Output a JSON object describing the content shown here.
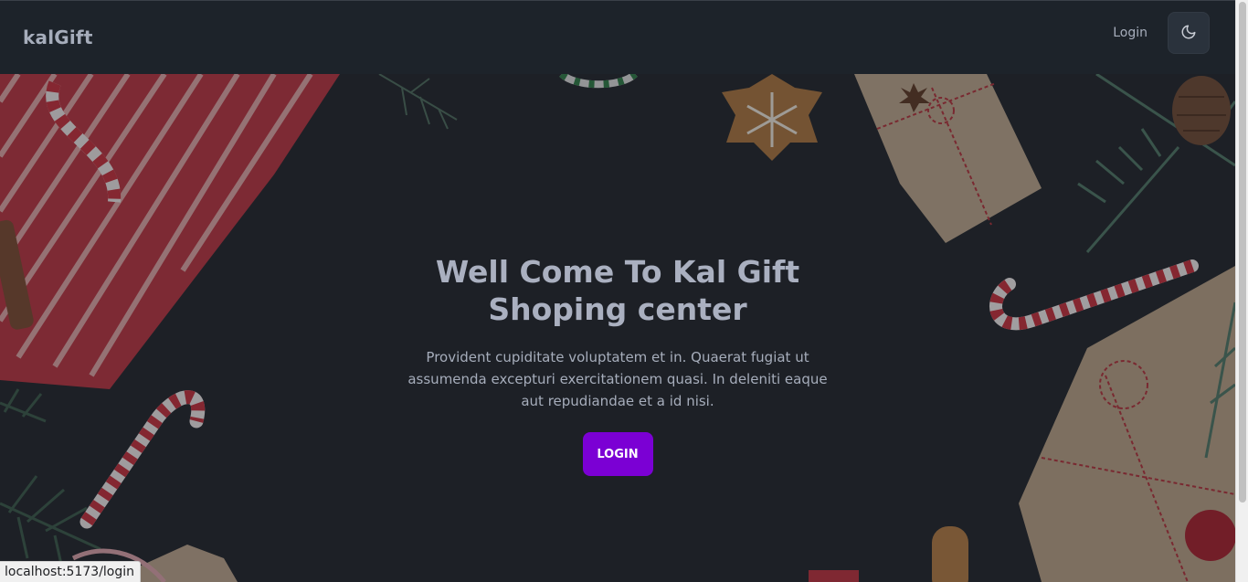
{
  "navbar": {
    "brand": "kalGift",
    "login_label": "Login",
    "theme_icon": "moon-icon"
  },
  "hero": {
    "title": "Well Come To Kal Gift Shoping center",
    "description": "Provident cupiditate voluptatem et in. Quaerat fugiat ut assumenda excepturi exercitationem quasi. In deleniti eaque aut repudiandae et a id nisi.",
    "button_label": "LOGIN"
  },
  "status_bar": {
    "url": "localhost:5173/login"
  },
  "colors": {
    "background": "#1d232a",
    "accent": "#7b00d4",
    "text": "#a6adbb"
  }
}
